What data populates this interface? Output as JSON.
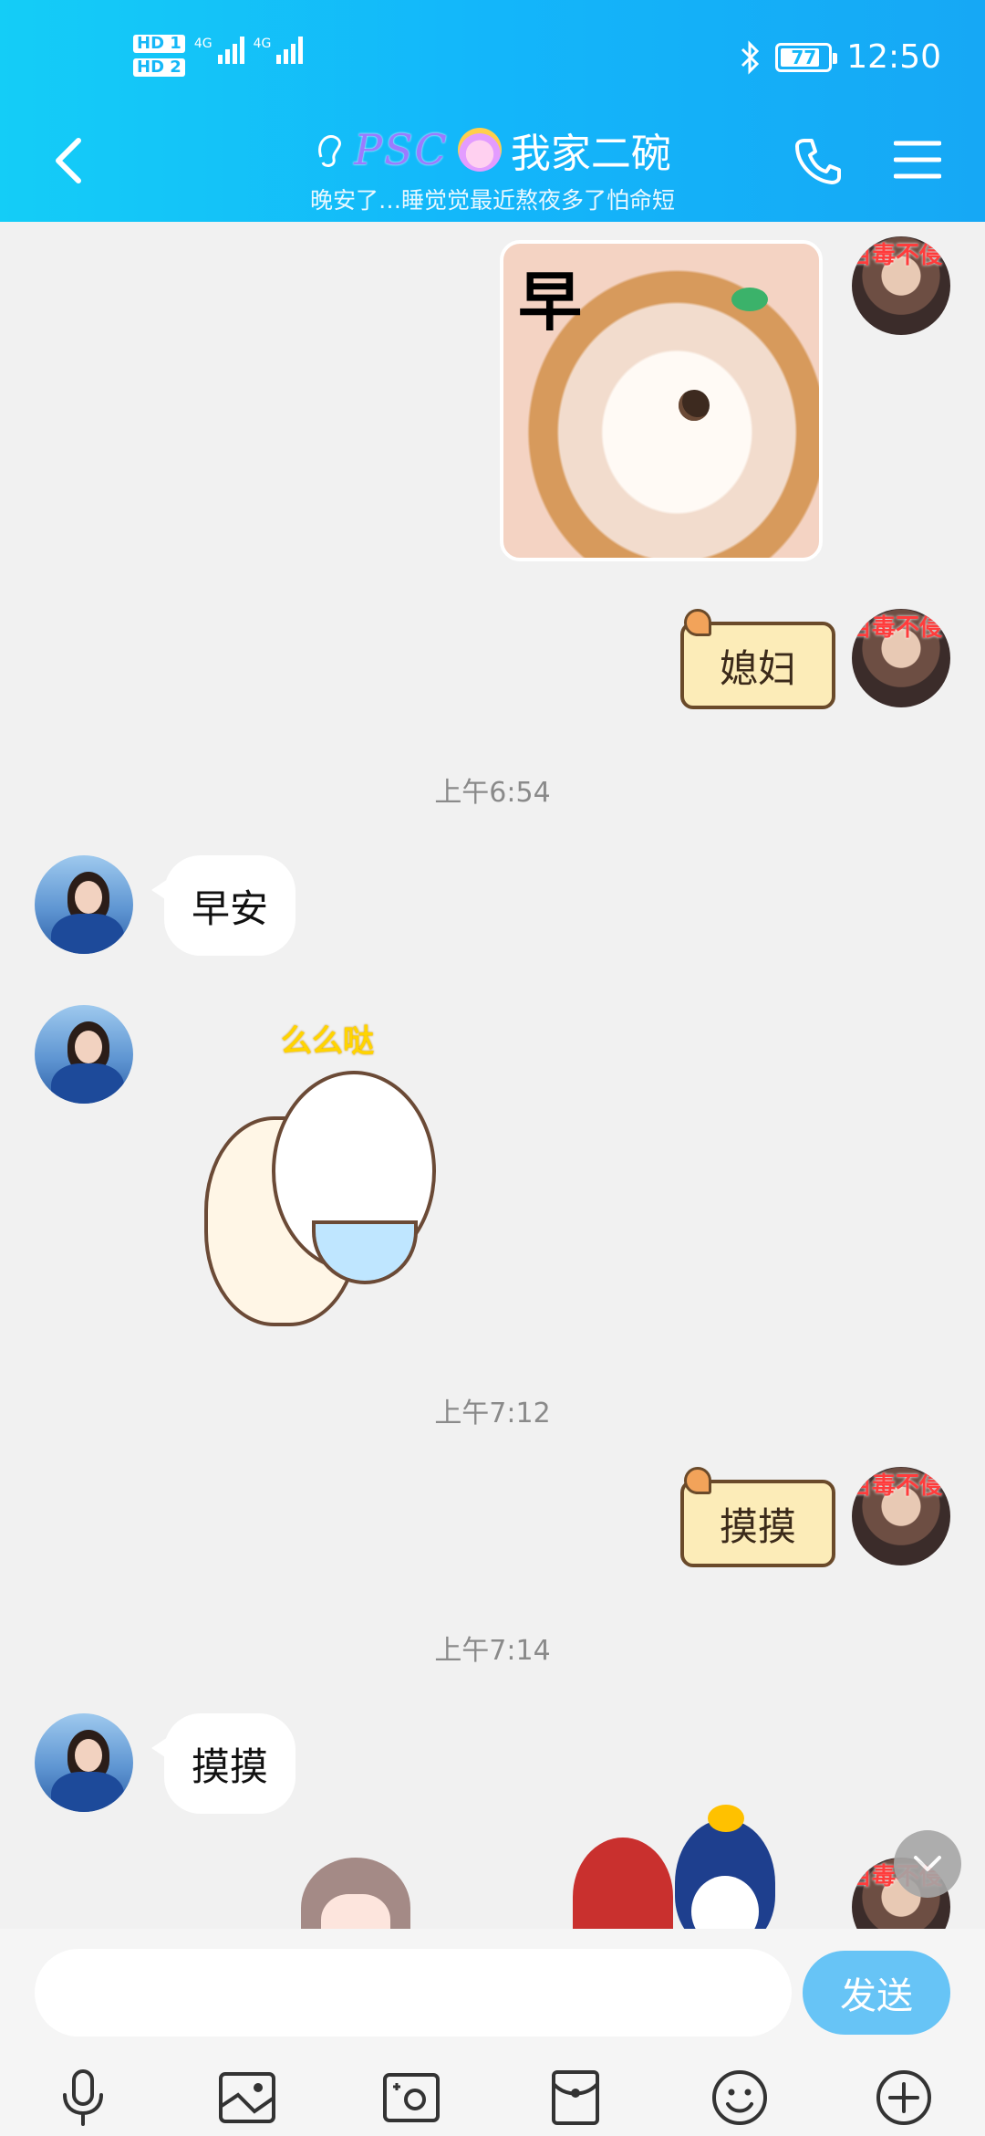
{
  "status_bar": {
    "hd1": "HD",
    "hd1_num": "1",
    "hd2": "HD",
    "hd2_num": "2",
    "sim1_net": "4G",
    "sim2_net": "4G",
    "battery": "77",
    "time": "12:50"
  },
  "header": {
    "contact_prefix": "PSC",
    "contact_name": "我家二碗",
    "signature": "晚安了…睡觉觉最近熬夜多了怕命短"
  },
  "messages": {
    "photo_sticker_text": "早",
    "sign_1_text": "媳妇",
    "time_1": "上午6:54",
    "bubble_1": "早安",
    "bear_sticker_text": "么么哒",
    "time_2": "上午7:12",
    "sign_2_text": "摸摸",
    "time_3": "上午7:14",
    "bubble_2": "摸摸",
    "avatar_tag": "百毒不侵"
  },
  "input": {
    "placeholder": "",
    "send_label": "发送"
  },
  "colors": {
    "header_start": "#14cdf7",
    "header_end": "#16a8f5",
    "send_button": "#67c4f6",
    "chat_bg": "#f1f1f1"
  },
  "icons": [
    "back-icon",
    "phone-icon",
    "menu-icon",
    "mic-icon",
    "image-icon",
    "camera-icon",
    "red-packet-icon",
    "emoji-icon",
    "plus-icon",
    "chevron-down-icon"
  ]
}
